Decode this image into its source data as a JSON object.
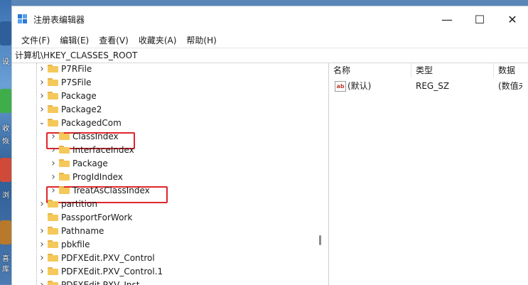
{
  "desktop": {
    "labels": [
      "设",
      "收",
      "恢",
      "浏",
      "喜",
      "库"
    ]
  },
  "window": {
    "title": "注册表编辑器",
    "controls": {
      "minimize": "—",
      "maximize": "☐",
      "close": "✕"
    }
  },
  "menu": [
    "文件(F)",
    "编辑(E)",
    "查看(V)",
    "收藏夹(A)",
    "帮助(H)"
  ],
  "address": "计算机\\HKEY_CLASSES_ROOT",
  "tree": {
    "items": [
      {
        "label": "P7RFile",
        "level": 0,
        "expanded": false
      },
      {
        "label": "P7SFile",
        "level": 0,
        "expanded": false
      },
      {
        "label": "Package",
        "level": 0,
        "expanded": false
      },
      {
        "label": "Package2",
        "level": 0,
        "expanded": false
      },
      {
        "label": "PackagedCom",
        "level": 0,
        "expanded": true
      },
      {
        "label": "ClassIndex",
        "level": 1,
        "expanded": false,
        "highlighted": true
      },
      {
        "label": "InterfaceIndex",
        "level": 1,
        "expanded": false
      },
      {
        "label": "Package",
        "level": 1,
        "expanded": false
      },
      {
        "label": "ProgIdIndex",
        "level": 1,
        "expanded": false
      },
      {
        "label": "TreatAsClassIndex",
        "level": 1,
        "expanded": false,
        "highlighted": true
      },
      {
        "label": "partition",
        "level": 0,
        "expanded": false
      },
      {
        "label": "PassportForWork",
        "level": 0,
        "expanded": null
      },
      {
        "label": "Pathname",
        "level": 0,
        "expanded": false
      },
      {
        "label": "pbkfile",
        "level": 0,
        "expanded": false
      },
      {
        "label": "PDFXEdit.PXV_Control",
        "level": 0,
        "expanded": false
      },
      {
        "label": "PDFXEdit.PXV_Control.1",
        "level": 0,
        "expanded": false
      },
      {
        "label": "PDFXEdit.PXV_Inst",
        "level": 0,
        "expanded": false
      }
    ]
  },
  "values": {
    "columns": [
      "名称",
      "类型",
      "数据"
    ],
    "rows": [
      {
        "name": "(默认)",
        "type": "REG_SZ",
        "data": "(数值未设置)"
      }
    ]
  },
  "colors": {
    "highlight": "#e0242b",
    "folder": "#f5c85a"
  }
}
